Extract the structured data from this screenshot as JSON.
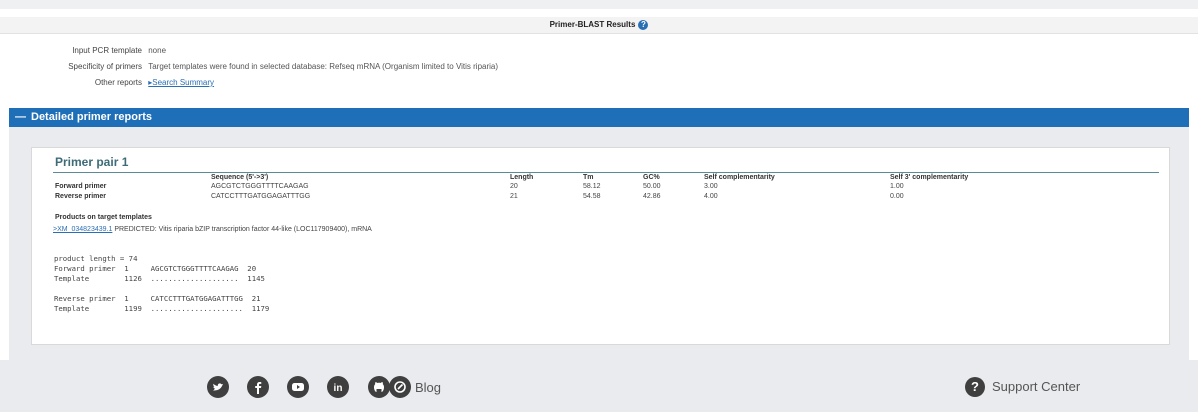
{
  "page": {
    "title": "Primer-BLAST Results",
    "help_icon": "question-icon"
  },
  "info": {
    "input_label": "Input PCR template",
    "input_value": "none",
    "specificity_label": "Specificity of primers",
    "specificity_value": "Target templates were found in selected database: Refseq mRNA (Organism limited to Vitis riparia)",
    "other_label": "Other reports",
    "other_link": "▸Search Summary"
  },
  "section": {
    "toggle": "—",
    "title": "Detailed primer reports"
  },
  "primer_pair": {
    "title": "Primer pair 1",
    "columns": [
      "Sequence (5'->3')",
      "Length",
      "Tm",
      "GC%",
      "Self complementarity",
      "Self 3' complementarity"
    ],
    "rows": [
      {
        "label": "Forward primer",
        "sequence": "AGCGTCTGGGTTTTCAAGAG",
        "length": "20",
        "tm": "58.12",
        "gc": "50.00",
        "self_comp": "3.00",
        "self3_comp": "1.00"
      },
      {
        "label": "Reverse primer",
        "sequence": "CATCCTTTGATGGAGATTTGG",
        "length": "21",
        "tm": "54.58",
        "gc": "42.86",
        "self_comp": "4.00",
        "self3_comp": "0.00"
      }
    ],
    "products_title": "Products on target templates",
    "product_link": ">XM_034823439.1",
    "product_desc": "PREDICTED: Vitis riparia bZIP transcription factor 44-like (LOC117909400), mRNA",
    "product_length": "product length = 74",
    "alignment_lines": [
      "Forward primer  1     AGCGTCTGGGTTTTCAAGAG  20",
      "Template        1126  ....................  1145",
      "",
      "Reverse primer  1     CATCCTTTGATGGAGATTTGG  21",
      "Template        1199  .....................  1179"
    ]
  },
  "footer": {
    "icons": [
      "twitter-icon",
      "facebook-icon",
      "youtube-icon",
      "linkedin-icon",
      "github-icon",
      "blog-icon"
    ],
    "blog_label": "Blog",
    "support_label": "Support Center"
  }
}
